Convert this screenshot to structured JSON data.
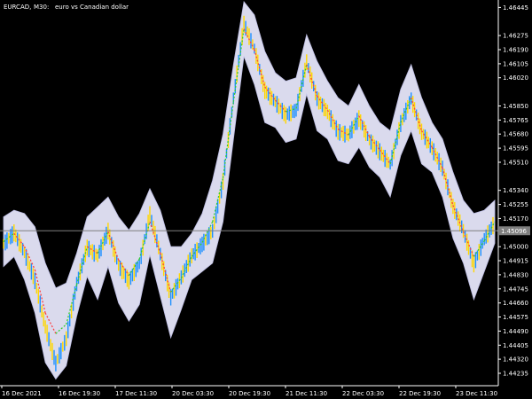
{
  "window": {
    "symbol": "EURCAD,",
    "timeframe": "M30:",
    "description": "euro vs Canadian dollar"
  },
  "current_price_label": "1.45096",
  "colors": {
    "background": "#000000",
    "text": "#ffffff",
    "price_line": "#7f7f7f",
    "band_fill": "#e6e6fa",
    "band_edge": "#c8c8f0",
    "bull_candle": "#1e90ff",
    "bear_candle": "#ffd700",
    "signal_up": "#32cd32",
    "signal_down": "#ff4040"
  },
  "chart_data": {
    "type": "line",
    "title": "",
    "xlabel": "",
    "ylabel": "",
    "ylim": [
      1.4416,
      1.4649
    ],
    "y_ticks": [
      "1.46445",
      "1.46275",
      "1.46190",
      "1.46105",
      "1.46020",
      "1.45850",
      "1.45765",
      "1.45680",
      "1.45595",
      "1.45510",
      "1.45340",
      "1.45255",
      "1.45170",
      "1.45000",
      "1.44915",
      "1.44830",
      "1.44745",
      "1.44660",
      "1.44575",
      "1.44490",
      "1.44405",
      "1.44320",
      "1.44235"
    ],
    "x_ticks": [
      "16 Dec 2021",
      "16 Dec 19:30",
      "17 Dec 11:30",
      "20 Dec 03:30",
      "20 Dec 19:30",
      "21 Dec 11:30",
      "22 Dec 03:30",
      "22 Dec 19:30",
      "23 Dec 11:30"
    ],
    "current_price": 1.45096,
    "series": [
      {
        "name": "",
        "values": [
          1.4502,
          1.4509,
          1.4497,
          1.448,
          1.4452,
          1.443,
          1.4445,
          1.4478,
          1.45,
          1.4495,
          1.451,
          1.4489,
          1.448,
          1.449,
          1.452,
          1.4496,
          1.447,
          1.4482,
          1.4495,
          1.4502,
          1.451,
          1.454,
          1.459,
          1.4635,
          1.462,
          1.4595,
          1.4588,
          1.458,
          1.4583,
          1.4612,
          1.459,
          1.4582,
          1.457,
          1.4568,
          1.4578,
          1.4565,
          1.4558,
          1.455,
          1.4575,
          1.459,
          1.457,
          1.456,
          1.4548,
          1.4525,
          1.451,
          1.449,
          1.4505,
          1.4515
        ]
      }
    ],
    "upper_band": [
      1.4518,
      1.4522,
      1.452,
      1.4512,
      1.449,
      1.4475,
      1.4478,
      1.4496,
      1.4518,
      1.4524,
      1.453,
      1.4518,
      1.451,
      1.452,
      1.4535,
      1.4522,
      1.45,
      1.45,
      1.4508,
      1.452,
      1.454,
      1.4568,
      1.461,
      1.4648,
      1.464,
      1.4618,
      1.4605,
      1.46,
      1.4602,
      1.4628,
      1.4612,
      1.46,
      1.459,
      1.4585,
      1.4598,
      1.4585,
      1.4575,
      1.457,
      1.4595,
      1.461,
      1.459,
      1.4575,
      1.4565,
      1.4545,
      1.4528,
      1.452,
      1.4522,
      1.4528
    ],
    "lower_band": [
      1.4488,
      1.4494,
      1.448,
      1.446,
      1.443,
      1.442,
      1.4428,
      1.4458,
      1.4482,
      1.4468,
      1.4488,
      1.4466,
      1.4455,
      1.4465,
      1.4495,
      1.447,
      1.4445,
      1.4462,
      1.448,
      1.4485,
      1.449,
      1.4515,
      1.4565,
      1.4615,
      1.4598,
      1.4575,
      1.4572,
      1.4563,
      1.4565,
      1.4592,
      1.457,
      1.4565,
      1.4552,
      1.455,
      1.456,
      1.4548,
      1.4542,
      1.453,
      1.4555,
      1.457,
      1.455,
      1.4545,
      1.453,
      1.4505,
      1.449,
      1.4468,
      1.4485,
      1.4502
    ]
  }
}
